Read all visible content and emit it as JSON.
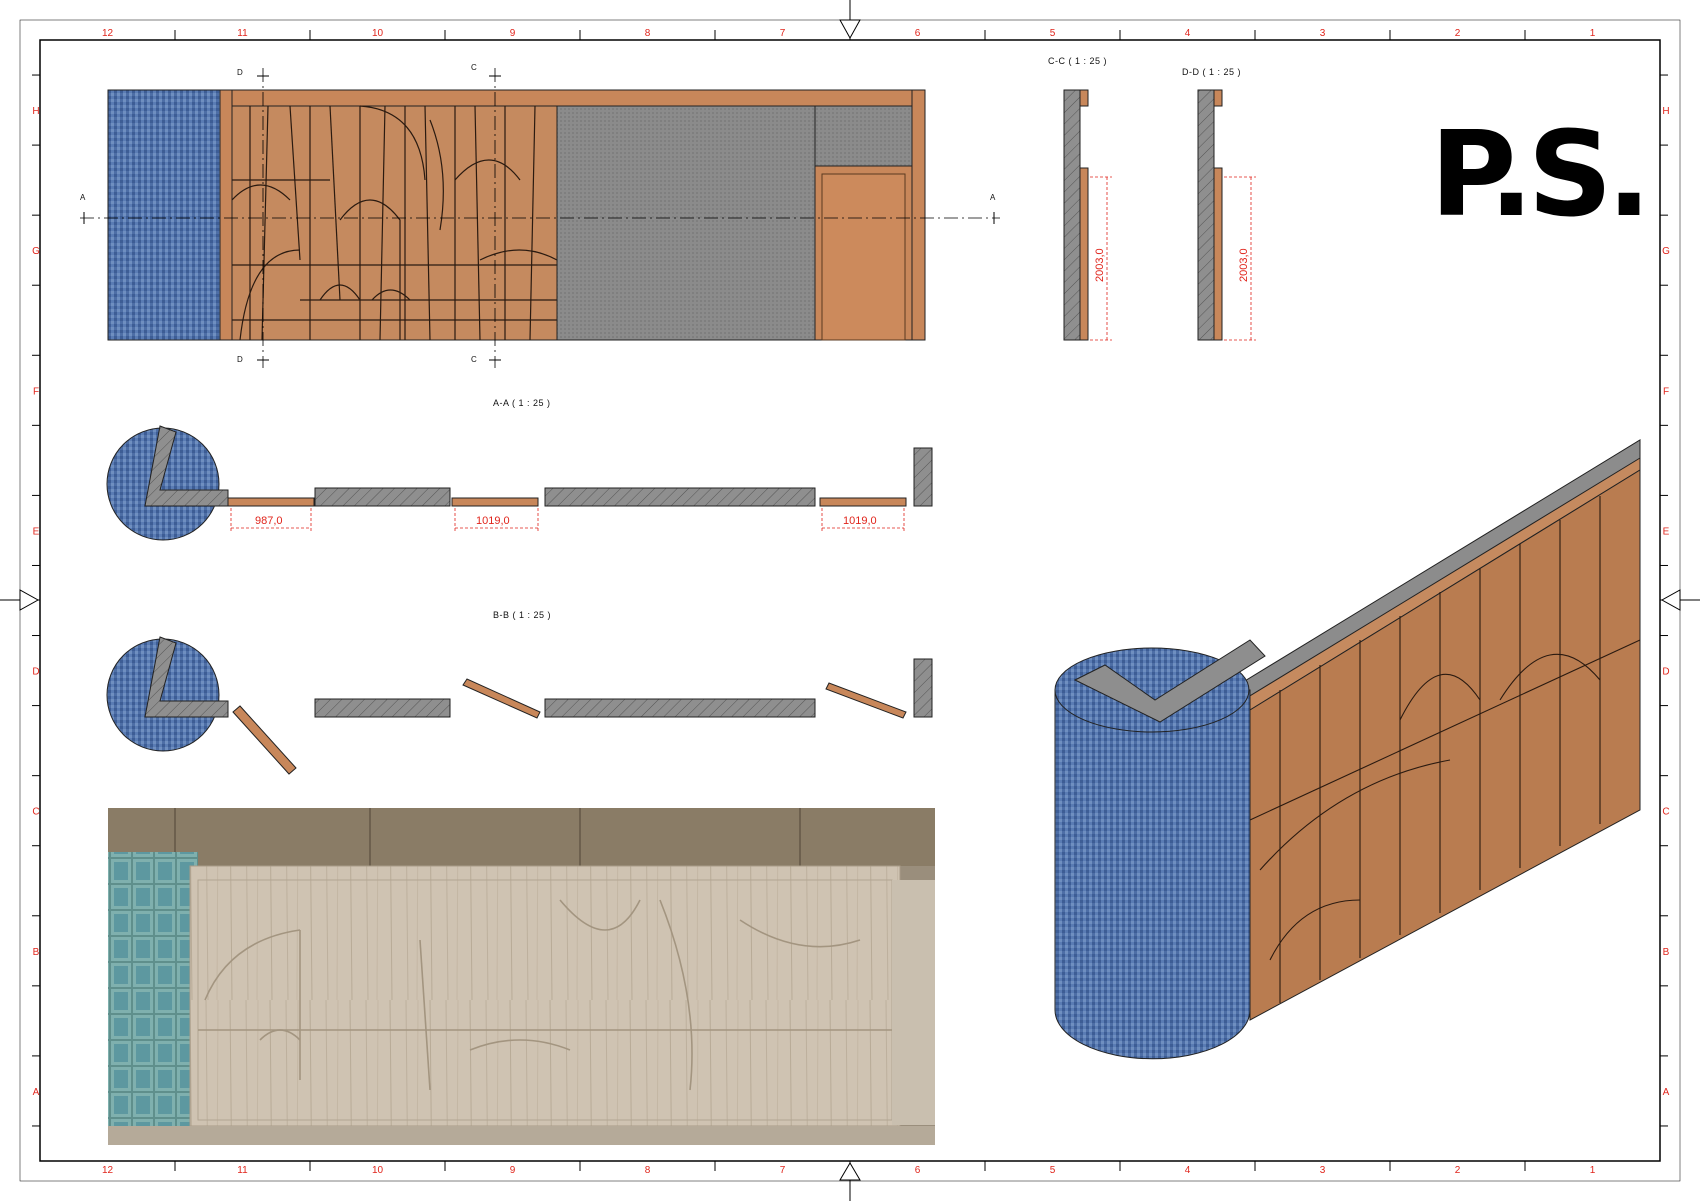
{
  "border": {
    "columns": [
      "12",
      "11",
      "10",
      "9",
      "8",
      "7",
      "6",
      "5",
      "4",
      "3",
      "2",
      "1"
    ],
    "rows": [
      "H",
      "G",
      "F",
      "E",
      "D",
      "C",
      "B",
      "A"
    ]
  },
  "logo": {
    "text": "P.S."
  },
  "sections": {
    "cc_title": "C-C ( 1 : 25 )",
    "dd_title": "D-D ( 1 : 25 )",
    "aa_title": "A-A ( 1 : 25 )",
    "bb_title": "B-B ( 1 : 25 )"
  },
  "markers": {
    "a": "A",
    "c": "C",
    "d": "D"
  },
  "dimensions": {
    "cc_height": "2003,0",
    "dd_height": "2003,0",
    "aa_width_1": "987,0",
    "aa_width_2": "1019,0",
    "aa_width_3": "1019,0"
  },
  "colors": {
    "grid_red": "#e0241b",
    "wood": "#c8875a",
    "wood_dark": "#a86a40",
    "grey_panel": "#8a8a8a",
    "mosaic_blue": "#4a6fa8",
    "render_oak": "#cbbfae"
  }
}
